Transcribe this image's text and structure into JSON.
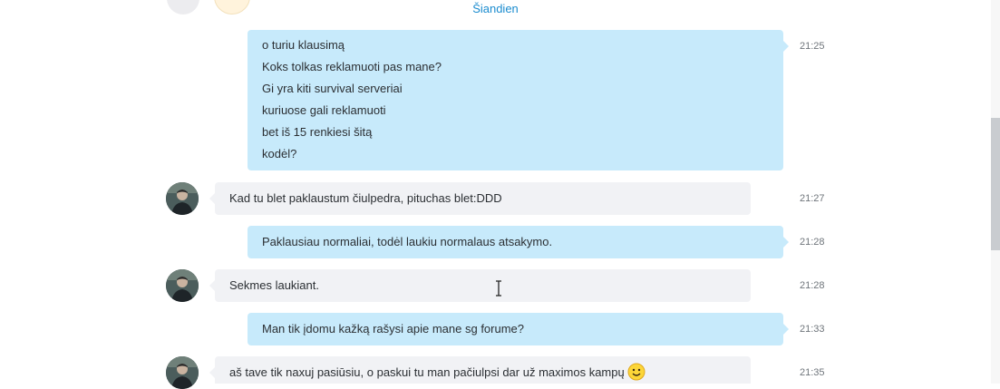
{
  "chat": {
    "day_separator": "Šiandien",
    "messages": [
      {
        "direction": "out",
        "time": "21:25",
        "lines": [
          "o turiu klausimą",
          "Koks tolkas reklamuoti pas mane?",
          "Gi yra kiti survival serveriai",
          "kuriuose gali reklamuoti",
          "bet iš 15 renkiesi šitą",
          "kodėl?"
        ]
      },
      {
        "direction": "in",
        "time": "21:27",
        "text": "Kad tu blet paklaustum čiulpedra, pituchas blet:DDD"
      },
      {
        "direction": "out",
        "time": "21:28",
        "text": "Paklausiau normaliai, todėl laukiu normalaus atsakymo."
      },
      {
        "direction": "in",
        "time": "21:28",
        "text": "Sekmes laukiant."
      },
      {
        "direction": "out",
        "time": "21:33",
        "text": "Man tik įdomu kažką rašysi apie mane sg forume?"
      },
      {
        "direction": "in",
        "time": "21:35",
        "text": "aš tave tik naxuj pasiūsiu, o paskui tu man pačiulpsi dar už maximos kampų",
        "emoji": "smile-emoji"
      }
    ]
  },
  "colors": {
    "outgoing_bubble": "#c7eafb",
    "incoming_bubble": "#f1f2f5",
    "day_separator": "#1b8ccf",
    "time": "#6f757b"
  },
  "icons": {
    "cursor": "text-cursor-icon",
    "emoji": "smile-emoji-icon"
  }
}
